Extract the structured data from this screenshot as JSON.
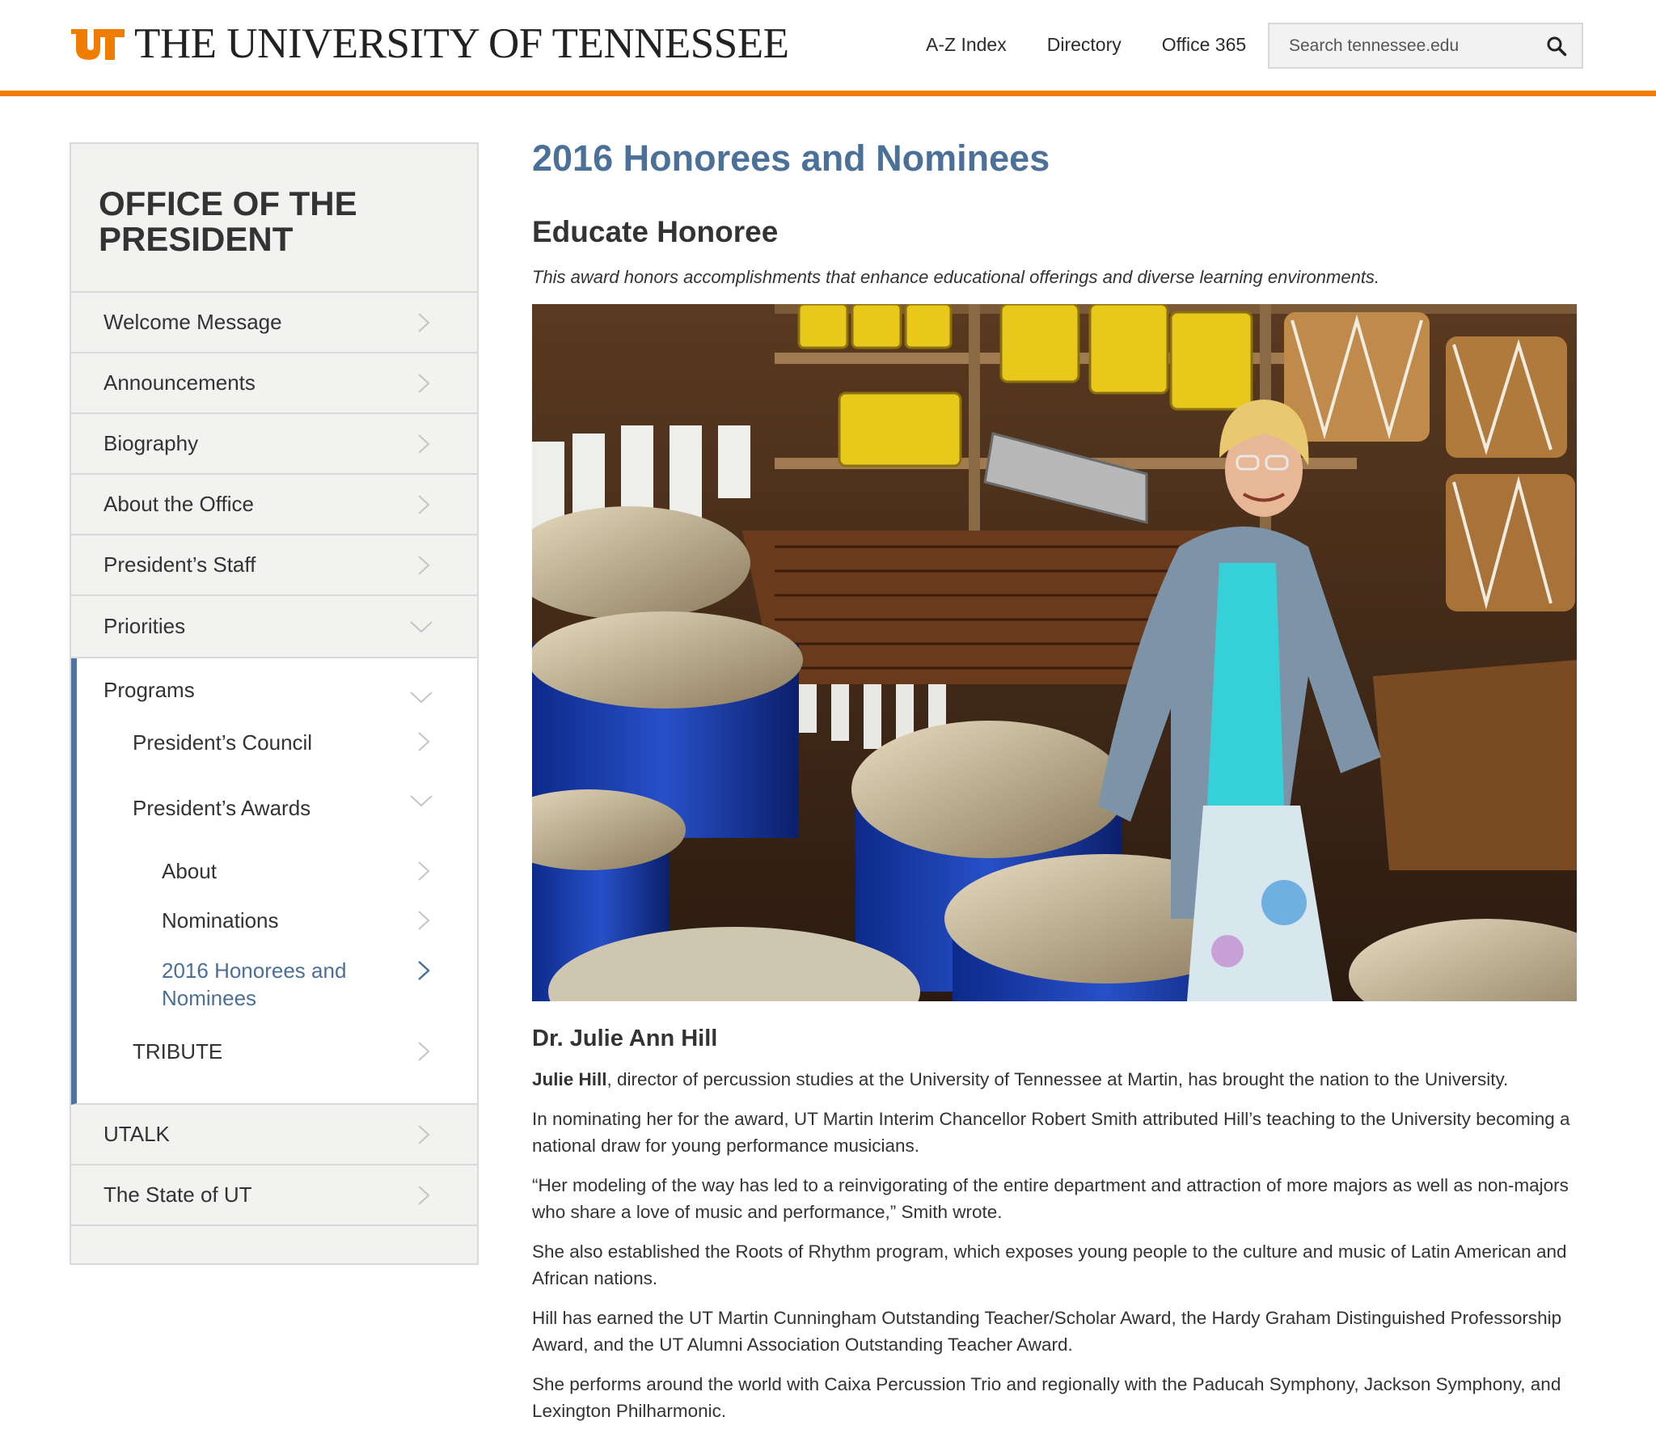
{
  "header": {
    "logo_text": "THE UNIVERSITY OF TENNESSEE",
    "nav": [
      "A-Z Index",
      "Directory",
      "Office 365"
    ],
    "search_placeholder": "Search tennessee.edu"
  },
  "colors": {
    "accent_orange": "#f07d00",
    "title_blue": "#4c7199",
    "active_bar": "#4f73a1",
    "sidebar_bg": "#f2f2f0"
  },
  "sidebar": {
    "title": "OFFICE OF THE PRESIDENT",
    "items": [
      {
        "label": "Welcome Message"
      },
      {
        "label": "Announcements"
      },
      {
        "label": "Biography"
      },
      {
        "label": "About the Office"
      },
      {
        "label": "President’s Staff"
      },
      {
        "label": "Priorities"
      }
    ],
    "programs": {
      "label": "Programs",
      "council": "President’s Council",
      "awards": "President’s Awards",
      "about": "About",
      "nominations": "Nominations",
      "honorees_line1": "2016 Honorees and",
      "honorees_line2": "Nominees",
      "tribute": "TRIBUTE"
    },
    "bottom_items": [
      {
        "label": "UTALK"
      },
      {
        "label": "The State of UT"
      }
    ]
  },
  "main": {
    "page_title": "2016 Honorees and Nominees",
    "section_title": "Educate Honoree",
    "award_description": "This award honors accomplishments that enhance educational offerings and diverse learning environments.",
    "person_name": "Dr. Julie Ann Hill",
    "lead_name": "Julie Hill",
    "paragraph1_rest": ", director of percussion studies at the University of Tennessee at Martin, has brought the nation to the University.",
    "paragraphs": [
      "In nominating her for the award, UT Martin Interim Chancellor Robert Smith attributed Hill’s teaching to the University becoming a national draw for young performance musicians.",
      "“Her modeling of the way has led to a reinvigorating of the entire department and attraction of more majors as well as non-majors who share a love of music and performance,” Smith wrote.",
      "She also established the Roots of Rhythm program, which exposes young people to the culture and music of Latin American and African nations.",
      "Hill has earned the UT Martin Cunningham Outstanding Teacher/Scholar Award, the Hardy Graham Distinguished Professorship Award, and the UT Alumni Association Outstanding Teacher Award.",
      "She performs around the world with Caixa Percussion Trio and regionally with the Paducah Symphony, Jackson Symphony, and Lexington Philharmonic."
    ]
  }
}
